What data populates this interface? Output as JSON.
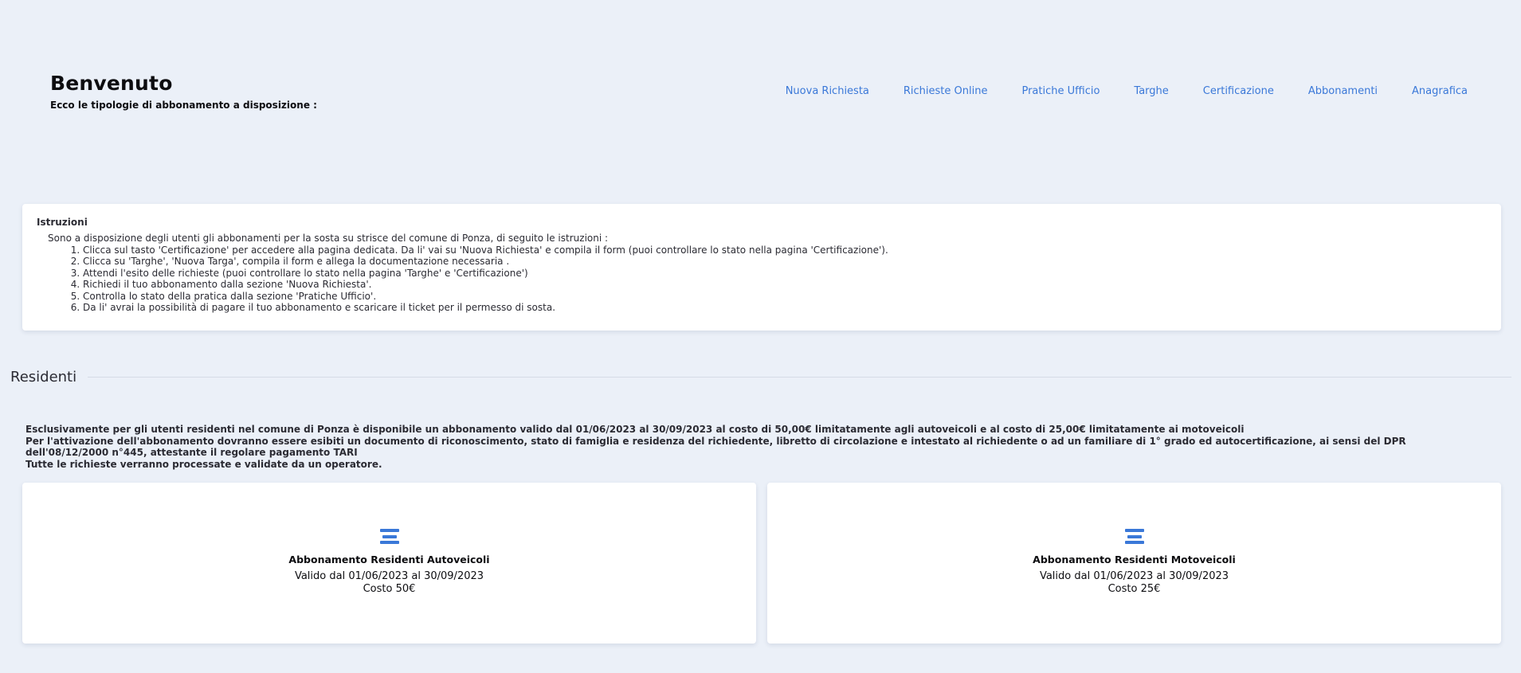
{
  "header": {
    "title": "Benvenuto",
    "subtitle": "Ecco le tipologie di abbonamento a disposizione :"
  },
  "nav": {
    "items": [
      {
        "label": "Nuova Richiesta"
      },
      {
        "label": "Richieste Online"
      },
      {
        "label": "Pratiche Ufficio"
      },
      {
        "label": "Targhe"
      },
      {
        "label": "Certificazione"
      },
      {
        "label": "Abbonamenti"
      },
      {
        "label": "Anagrafica"
      }
    ]
  },
  "instructions": {
    "title": "Istruzioni",
    "intro": "Sono a disposizione degli utenti gli abbonamenti per la sosta su strisce del comune di Ponza, di seguito le istruzioni :",
    "steps": [
      "Clicca sul tasto 'Certificazione' per accedere alla pagina dedicata. Da li' vai su 'Nuova Richiesta' e compila il form (puoi controllare lo stato nella pagina 'Certificazione').",
      "Clicca su 'Targhe', 'Nuova Targa', compila il form e allega la documentazione necessaria .",
      "Attendi l'esito delle richieste (puoi controllare lo stato nella pagina 'Targhe' e 'Certificazione')",
      "Richiedi il tuo abbonamento dalla sezione 'Nuova Richiesta'.",
      "Controlla lo stato della pratica dalla sezione 'Pratiche Ufficio'.",
      "Da li' avrai la possibilità di pagare il tuo abbonamento e scaricare il ticket per il permesso di sosta."
    ]
  },
  "section": {
    "title": "Residenti",
    "desc_line1": "Esclusivamente per gli utenti residenti nel comune di Ponza è disponibile un abbonamento valido dal 01/06/2023 al 30/09/2023 al costo di 50,00€ limitatamente agli autoveicoli e al costo di 25,00€ limitatamente ai motoveicoli",
    "desc_line2": "Per l'attivazione dell'abbonamento dovranno essere esibiti un documento di riconoscimento, stato di famiglia e residenza del richiedente, libretto di circolazione e intestato al richiedente o ad un familiare di 1° grado ed autocertificazione, ai sensi del DPR dell'08/12/2000 n°445, attestante il regolare pagamento TARI",
    "desc_line3": "Tutte le richieste verranno processate e validate da un operatore."
  },
  "cards": [
    {
      "icon": "menu-lines-icon",
      "name": "Abbonamento Residenti Autoveicoli",
      "valid": "Valido dal 01/06/2023 al 30/09/2023",
      "cost": "Costo 50€"
    },
    {
      "icon": "menu-lines-icon",
      "name": "Abbonamento Residenti Motoveicoli",
      "valid": "Valido dal 01/06/2023 al 30/09/2023",
      "cost": "Costo 25€"
    }
  ],
  "colors": {
    "background": "#ebf0f8",
    "accent": "#3a78d8"
  }
}
